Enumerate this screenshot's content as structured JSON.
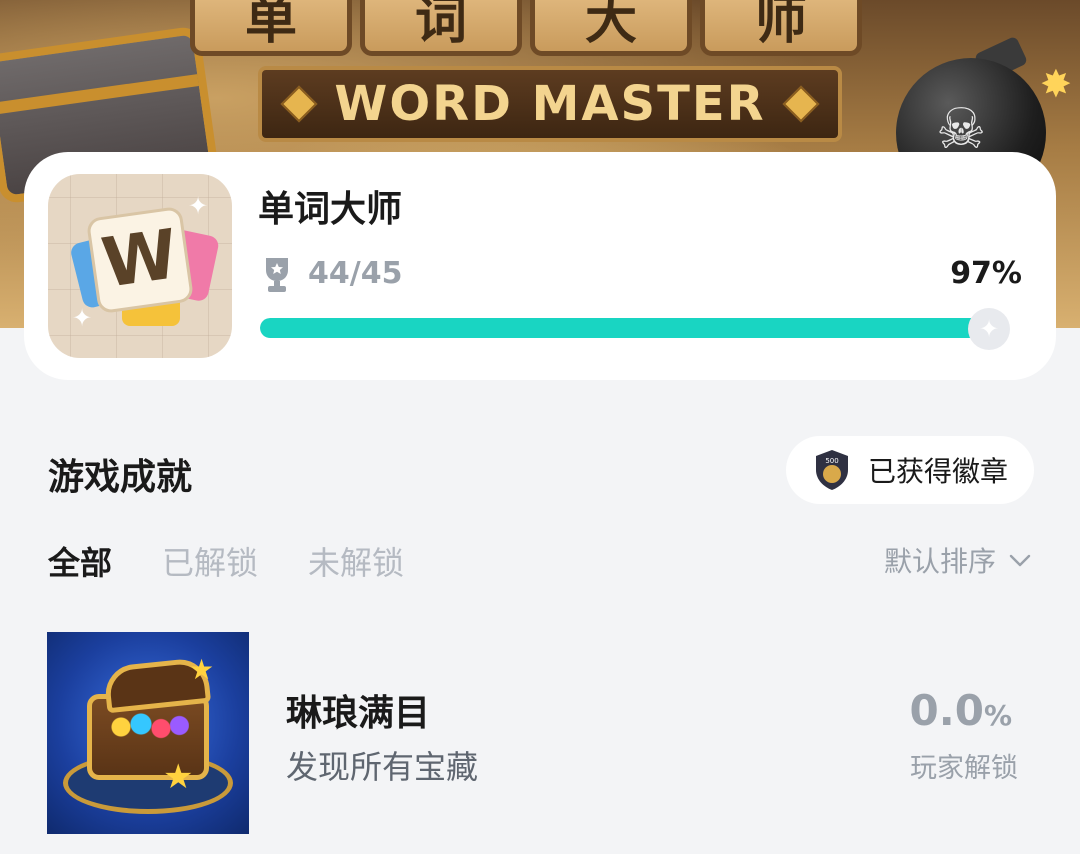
{
  "hero": {
    "tiles": [
      "单",
      "词",
      "大",
      "师"
    ],
    "banner_text": "WORD MASTER"
  },
  "game": {
    "title": "单词大师",
    "icon_letter": "W",
    "achieved": "44/45",
    "percent_text": "97%",
    "progress": 0.97,
    "accent_color": "#19d5c2"
  },
  "section": {
    "title": "游戏成就",
    "badge_button": "已获得徽章",
    "badge_icon_text": "500"
  },
  "tabs": [
    {
      "label": "全部",
      "active": true
    },
    {
      "label": "已解锁",
      "active": false
    },
    {
      "label": "未解锁",
      "active": false
    }
  ],
  "sort": {
    "label": "默认排序"
  },
  "achievements": [
    {
      "name": "琳琅满目",
      "description": "发现所有宝藏",
      "percent_value": "0.0",
      "percent_unit": "%",
      "players_label": "玩家解锁"
    }
  ]
}
